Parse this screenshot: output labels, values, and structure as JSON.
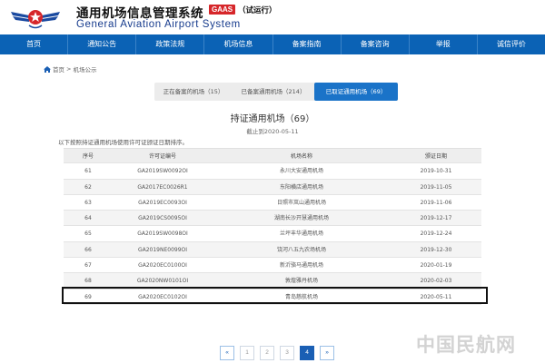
{
  "header": {
    "title_cn": "通用机场信息管理系统",
    "badge": "GAAS",
    "trial": "（试运行）",
    "title_en": "General Aviation Airport System",
    "logo_icon": "wings-star-logo-icon",
    "brand_color": "#0b62b5"
  },
  "nav": {
    "items": [
      {
        "label": "首页"
      },
      {
        "label": "通知公告"
      },
      {
        "label": "政策法规"
      },
      {
        "label": "机场信息"
      },
      {
        "label": "备案指南"
      },
      {
        "label": "备案咨询"
      },
      {
        "label": "举报"
      },
      {
        "label": "诚信评价"
      }
    ]
  },
  "breadcrumb": {
    "home": "首页",
    "separator": ">",
    "current": "机场公示",
    "home_icon": "home-icon"
  },
  "tabs": [
    {
      "label": "正在备案的机场（15）",
      "active": false
    },
    {
      "label": "已备案通用机场（214）",
      "active": false
    },
    {
      "label": "已取证通用机场（69）",
      "active": true
    }
  ],
  "main": {
    "heading": "持证通用机场（69）",
    "as_of": "截止到2020-05-11",
    "intro": "以下按照持证通用机场使用许可证颁证日期排序。"
  },
  "table": {
    "headers": {
      "no": "序号",
      "license": "许可证编号",
      "name": "机场名称",
      "date": "颁证日期"
    },
    "rows": [
      {
        "no": "61",
        "license": "GA2019SW0092OI",
        "name": "永川大安通用机场",
        "date": "2019-10-31"
      },
      {
        "no": "62",
        "license": "GA2017EC0026R1",
        "name": "东阳横店通用机场",
        "date": "2019-11-05"
      },
      {
        "no": "63",
        "license": "GA2019EC0093OI",
        "name": "日照市岚山通用机场",
        "date": "2019-11-06"
      },
      {
        "no": "64",
        "license": "GA2019CS0095OI",
        "name": "湖南长沙开慧通用机场",
        "date": "2019-12-17"
      },
      {
        "no": "65",
        "license": "GA2019SW0098OI",
        "name": "兰坪丰华通用机场",
        "date": "2019-12-24"
      },
      {
        "no": "66",
        "license": "GA2019NE0099OI",
        "name": "饶河八五九农场机场",
        "date": "2019-12-30"
      },
      {
        "no": "67",
        "license": "GA2020EC0100OI",
        "name": "新沂骆马通用机场",
        "date": "2020-01-19"
      },
      {
        "no": "68",
        "license": "GA2020NW0101OI",
        "name": "敦煌雅丹机场",
        "date": "2020-02-03"
      },
      {
        "no": "69",
        "license": "GA2020EC0102OI",
        "name": "青岛慈航机场",
        "date": "2020-05-11"
      }
    ]
  },
  "pagination": {
    "prev": "«",
    "pages": [
      "1",
      "2",
      "3",
      "4"
    ],
    "current": "4",
    "next": "»"
  },
  "watermark": "中国民航网"
}
